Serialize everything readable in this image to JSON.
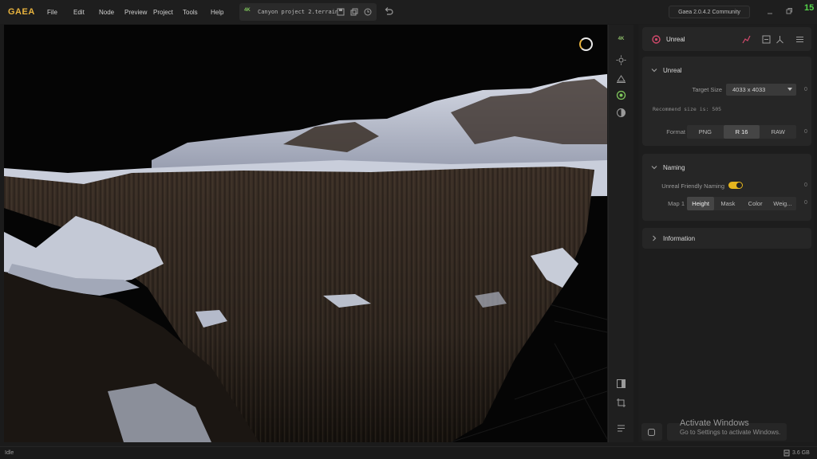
{
  "app": {
    "logo": "GAEA"
  },
  "menu": [
    {
      "label": "File"
    },
    {
      "label": "Edit"
    },
    {
      "label": "Node"
    },
    {
      "label": "Preview"
    },
    {
      "label": "Project"
    },
    {
      "label": "Tools"
    },
    {
      "label": "Help"
    }
  ],
  "project": {
    "badge": "4K",
    "name": "Canyon project 2.terrain"
  },
  "version": "Gaea 2.0.4.2 Community",
  "fps": "15",
  "toolbar": {
    "resolution_badge": "4K",
    "icons": [
      "resolution-icon",
      "sun-icon",
      "bake-icon",
      "render-icon",
      "contrast-icon",
      "split-view-icon",
      "crop-icon",
      "settings-list-icon"
    ]
  },
  "panel": {
    "node_name": "Unreal",
    "sections": {
      "unreal": {
        "title": "Unreal",
        "target_size_label": "Target Size",
        "target_size_value": "4033 x 4033",
        "target_size_zero": "0",
        "recommend": "Recommend size is: 505",
        "format_label": "Format",
        "format_options": [
          "PNG",
          "R 16",
          "RAW"
        ],
        "format_selected": "R 16",
        "format_zero": "0"
      },
      "naming": {
        "title": "Naming",
        "friendly_label": "Unreal Friendly Naming",
        "friendly_enabled": true,
        "friendly_zero": "0",
        "map1_label": "Map 1",
        "map1_options": [
          "Height",
          "Mask",
          "Color",
          "Weig..."
        ],
        "map1_selected": "Height",
        "map1_zero": "0"
      },
      "information": {
        "title": "Information"
      }
    }
  },
  "watermark": {
    "title": "Activate Windows",
    "subtitle": "Go to Settings to activate Windows."
  },
  "status": {
    "text": "Idle",
    "memory": "3.6 GB"
  },
  "colors": {
    "accent": "#e8b33e",
    "toggle": "#e5b51e",
    "fps": "#55d64a"
  }
}
